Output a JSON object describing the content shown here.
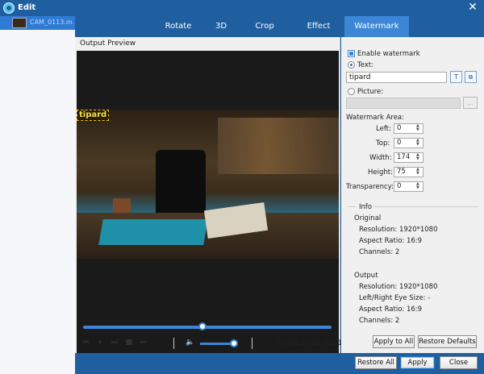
{
  "window": {
    "title": "Edit",
    "close_glyph": "✕"
  },
  "filelist": {
    "items": [
      {
        "name": "CAM_0113.m..."
      }
    ]
  },
  "tabs": [
    {
      "label": "Rotate"
    },
    {
      "label": "3D"
    },
    {
      "label": "Crop"
    },
    {
      "label": "Effect"
    },
    {
      "label": "Watermark",
      "active": true
    }
  ],
  "preview": {
    "label": "Output Preview",
    "watermark_text": "tipard",
    "seek_progress": 0.48,
    "volume": 0.95,
    "time_display": "00:00:10/00:00:21"
  },
  "controls": {
    "prev_glyph": "⏮",
    "pause_glyph": "⏸",
    "next_frame_glyph": "⏭",
    "stop_glyph": "■",
    "end_glyph": "⏭",
    "volume_glyph": "🔈"
  },
  "watermark": {
    "enable_label": "Enable watermark",
    "enable_checked": true,
    "text_label": "Text:",
    "text_selected": true,
    "text_value": "tipard",
    "font_button": "T",
    "color_button": "⧉",
    "picture_label": "Picture:",
    "picture_value": "",
    "browse_label": "...",
    "area_label": "Watermark Area:",
    "left_label": "Left:",
    "left_value": "0",
    "top_label": "Top:",
    "top_value": "0",
    "width_label": "Width:",
    "width_value": "174",
    "height_label": "Height:",
    "height_value": "75",
    "transparency_label": "Transparency:",
    "transparency_value": "0"
  },
  "info": {
    "title": "Info",
    "original_heading": "Original",
    "original": {
      "resolution": "Resolution: 1920*1080",
      "aspect": "Aspect Ratio: 16:9",
      "channels": "Channels: 2"
    },
    "output_heading": "Output",
    "output": {
      "resolution": "Resolution: 1920*1080",
      "eye_size": "Left/Right Eye Size: -",
      "aspect": "Aspect Ratio: 16:9",
      "channels": "Channels: 2"
    }
  },
  "buttons": {
    "apply_to_all": "Apply to All",
    "restore_defaults": "Restore Defaults",
    "restore_all": "Restore All",
    "apply": "Apply",
    "close": "Close"
  },
  "colors": {
    "frame_blue": "#1f5fa0",
    "active_tab": "#3b86d6",
    "watermark_yellow": "#f8e23a"
  }
}
